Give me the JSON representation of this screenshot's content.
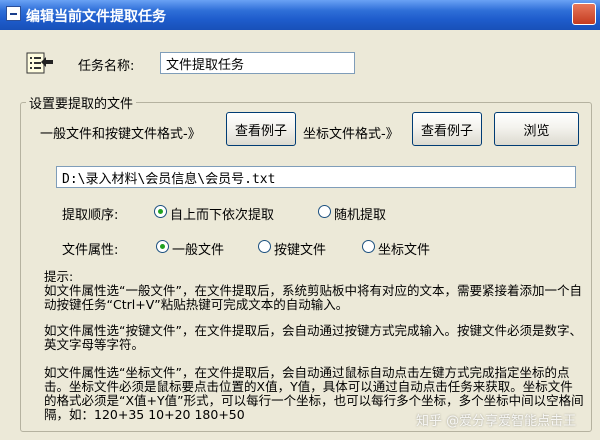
{
  "window": {
    "title": "编辑当前文件提取任务"
  },
  "task": {
    "label": "任务名称:",
    "value": "文件提取任务"
  },
  "group": {
    "title": "设置要提取的文件",
    "general_format_label": "一般文件和按键文件格式-》",
    "coord_format_label": "坐标文件格式-》",
    "example_button_1": "查看例子",
    "example_button_2": "查看例子",
    "browse_button": "浏览",
    "path_value": "D:\\录入材料\\会员信息\\会员号.txt",
    "order": {
      "label": "提取顺序:",
      "options": [
        "自上而下依次提取",
        "随机提取"
      ],
      "selected": 0
    },
    "attribute": {
      "label": "文件属性:",
      "options": [
        "一般文件",
        "按键文件",
        "坐标文件"
      ],
      "selected": 0
    }
  },
  "tips": {
    "heading": "提示:",
    "paragraph_1": "如文件属性选“一般文件”，在文件提取后，系统剪贴板中将有对应的文本，需要紧接着添加一个自动按键任务“Ctrl+V”粘贴热键可完成文本的自动输入。",
    "paragraph_2": "如文件属性选“按键文件”，在文件提取后，会自动通过按键方式完成输入。按键文件必须是数字、英文字母等字符。",
    "paragraph_3": "如文件属性选“坐标文件”，在文件提取后，会自动通过鼠标自动点击左键方式完成指定坐标的点击。坐标文件必须是鼠标要点击位置的X值，Y值，具体可以通过自动点击任务来获取。坐标文件的格式必须是“X值+Y值”形式，可以每行一个坐标，也可以每行多个坐标，多个坐标中间以空格间隔，如：120+35 10+20 180+50"
  },
  "watermark": "知乎 @爱分享爱智能点击王"
}
